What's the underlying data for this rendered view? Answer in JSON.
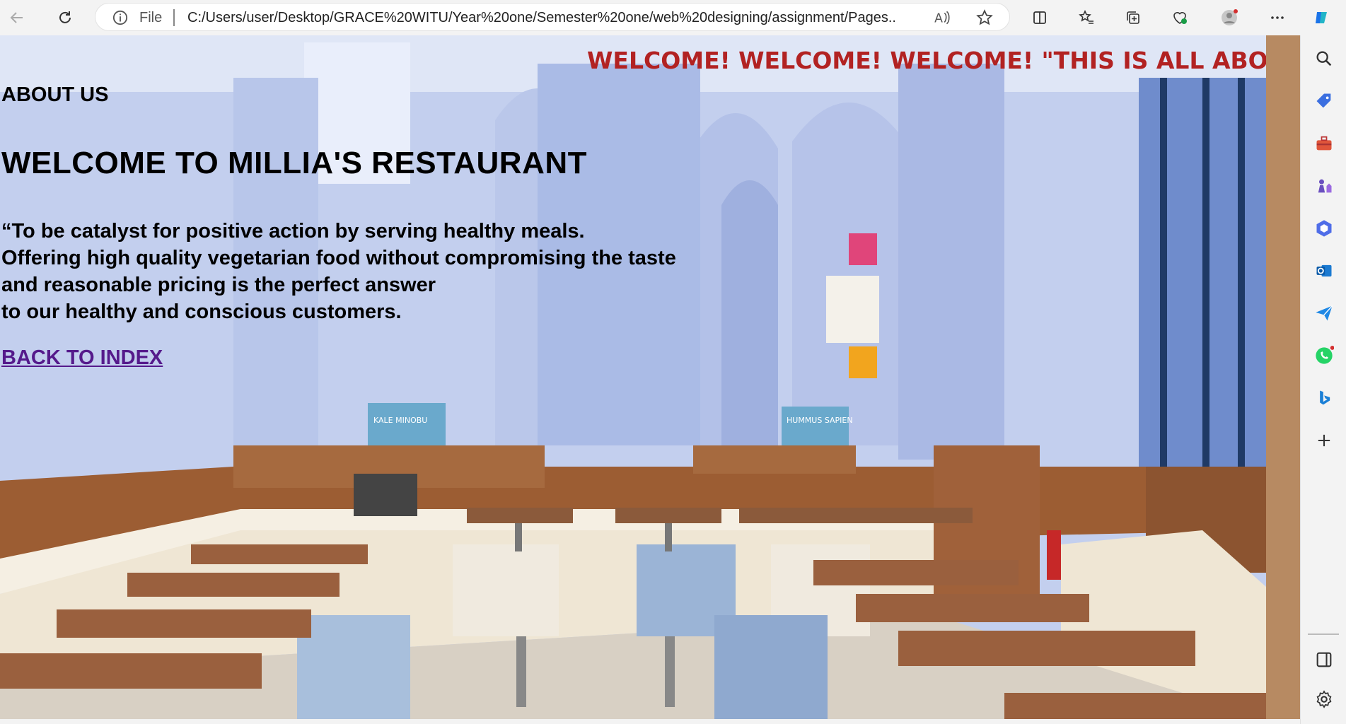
{
  "browser": {
    "file_label": "File",
    "url": "C:/Users/user/Desktop/GRACE%20WITU/Year%20one/Semester%20one/web%20designing/assignment/Pages..."
  },
  "page": {
    "marquee_text": "WELCOME! WELCOME! WELCOME! \"THIS IS ALL ABOUT",
    "about_heading": "ABOUT US",
    "main_title": "WELCOME TO MILLIA'S RESTAURANT",
    "mission_lines": [
      "“To be catalyst for positive action by serving healthy meals.",
      "Offering high quality vegetarian food without compromising the taste",
      "and reasonable pricing is the perfect answer",
      "to our healthy and conscious customers."
    ],
    "back_link": "BACK TO INDEX",
    "bag_labels": [
      "KALE MINOBU",
      "HUMMUS SAPIEN"
    ]
  },
  "colors": {
    "marquee": "#b22222",
    "link_visited": "#551a8b",
    "wall": "#c9d4ef",
    "wood": "#a0613a",
    "seat_cream": "#efe6d4"
  }
}
